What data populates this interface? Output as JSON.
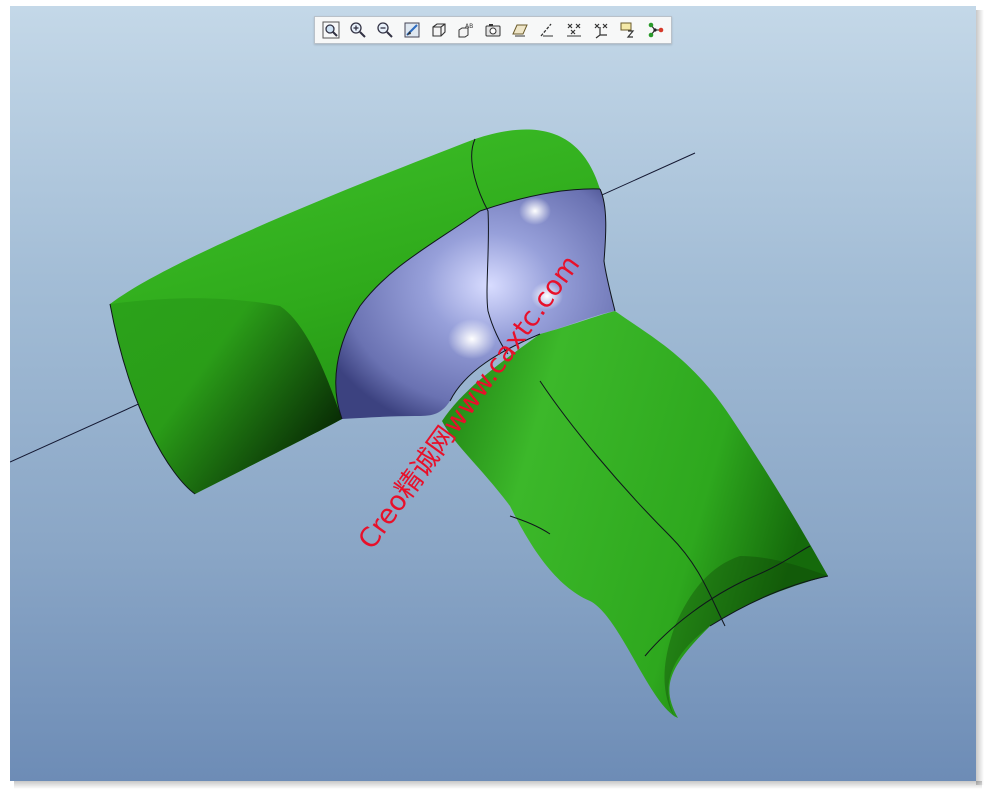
{
  "toolbar": {
    "buttons": [
      {
        "name": "refit-icon"
      },
      {
        "name": "zoom-in-icon"
      },
      {
        "name": "zoom-out-icon"
      },
      {
        "name": "repaint-icon"
      },
      {
        "name": "display-style-icon"
      },
      {
        "name": "saved-orientations-icon"
      },
      {
        "name": "view-manager-icon"
      },
      {
        "name": "datum-planes-icon"
      },
      {
        "name": "datum-axes-icon"
      },
      {
        "name": "datum-points-icon"
      },
      {
        "name": "coordinate-systems-icon"
      },
      {
        "name": "annotations-icon"
      },
      {
        "name": "spin-center-icon"
      }
    ]
  },
  "watermark": "Creo精诚网www.caxtc.com",
  "colors": {
    "surface_green": "#33b020",
    "surface_blue": "#8e96d0",
    "background_top": "#c4d8e8",
    "background_bottom": "#6d8cb6",
    "watermark": "#e8102a"
  }
}
